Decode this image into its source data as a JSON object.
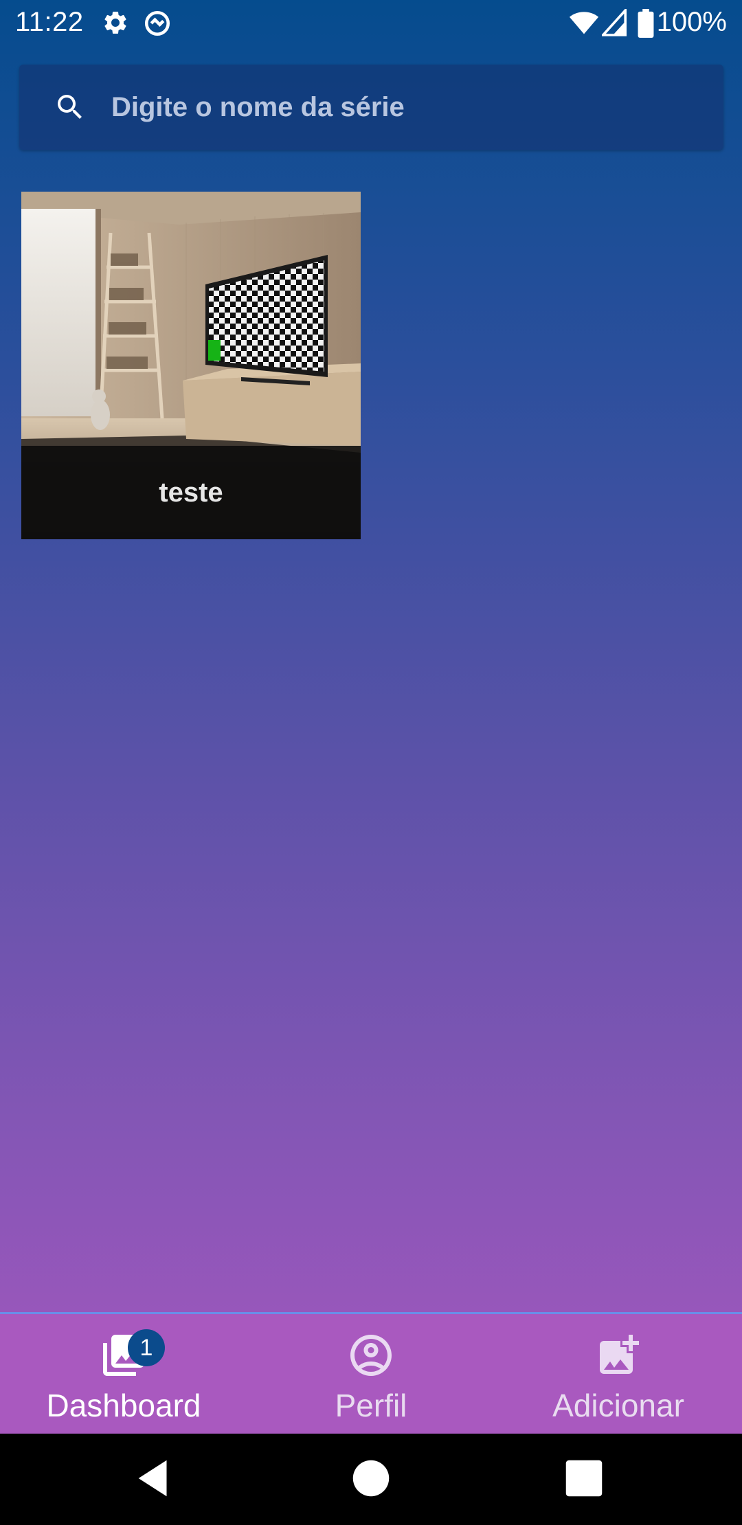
{
  "status_bar": {
    "time": "11:22",
    "battery": "100%",
    "icons": [
      "settings-gear-icon",
      "sync-icon",
      "wifi-icon",
      "signal-icon",
      "battery-icon"
    ]
  },
  "search": {
    "placeholder": "Digite o nome da série",
    "value": "",
    "icon": "search-icon"
  },
  "series": [
    {
      "title": "teste",
      "image": "living-room-tv-thumbnail"
    }
  ],
  "bottom_nav": {
    "items": [
      {
        "label": "Dashboard",
        "icon": "photo-library-icon",
        "badge": "1",
        "active": true
      },
      {
        "label": "Perfil",
        "icon": "account-circle-icon",
        "active": false
      },
      {
        "label": "Adicionar",
        "icon": "add-photo-icon",
        "active": false
      }
    ]
  },
  "system_nav": {
    "buttons": [
      "back-icon",
      "home-icon",
      "recents-icon"
    ]
  },
  "colors": {
    "gradient_top": "#054c8e",
    "gradient_bottom": "#ad58c1",
    "nav_background": "#a959bf",
    "badge": "#0b4b8c"
  }
}
